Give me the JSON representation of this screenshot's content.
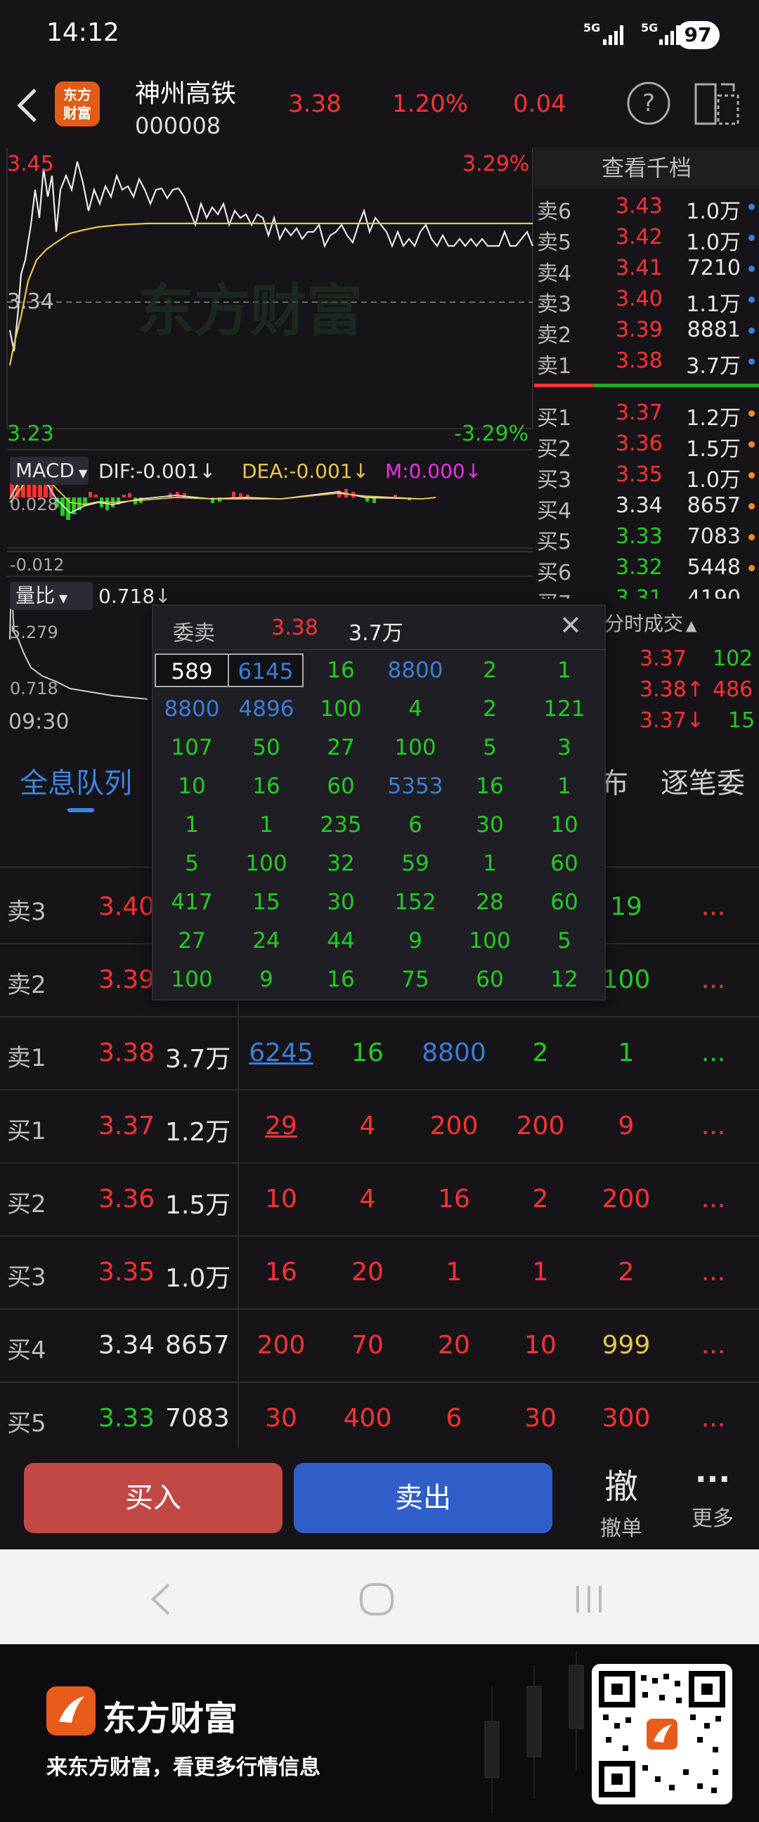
{
  "status_bar": {
    "time": "14:12",
    "net1": "5G",
    "net2": "5G",
    "battery": "97"
  },
  "header": {
    "logo_text_1": "东方",
    "logo_text_2": "财富",
    "stock_name": "神州高铁",
    "stock_code": "000008",
    "price": "3.38",
    "change_pct": "1.20%",
    "change": "0.04"
  },
  "chart": {
    "high_price": "3.45",
    "high_pct": "3.29%",
    "mid_price": "3.34",
    "low_price": "3.23",
    "low_pct": "-3.29%",
    "watermark": "东方财富",
    "macd_label": "MACD",
    "dif": "DIF:-0.001",
    "dea": "DEA:-0.001",
    "m": "M:0.000",
    "macd_top": "0.028",
    "macd_bottom": "-0.012",
    "volratio_label": "量比",
    "volratio_value": "0.718",
    "vr_top": "5.279",
    "vr_bottom": "0.718",
    "time_start": "09:30",
    "arrow_down": "↓",
    "colors": {
      "up": "#ff3232",
      "down": "#22cc22",
      "price_line": "#e8e8e8",
      "avg_line": "#e6c84a"
    }
  },
  "order_book": {
    "title": "查看千档",
    "asks": [
      {
        "label": "卖6",
        "price": "3.43",
        "vol": "1.0万"
      },
      {
        "label": "卖5",
        "price": "3.42",
        "vol": "1.0万"
      },
      {
        "label": "卖4",
        "price": "3.41",
        "vol": "7210"
      },
      {
        "label": "卖3",
        "price": "3.40",
        "vol": "1.1万"
      },
      {
        "label": "卖2",
        "price": "3.39",
        "vol": "8881"
      },
      {
        "label": "卖1",
        "price": "3.38",
        "vol": "3.7万"
      }
    ],
    "bids": [
      {
        "label": "买1",
        "price": "3.37",
        "vol": "1.2万"
      },
      {
        "label": "买2",
        "price": "3.36",
        "vol": "1.5万"
      },
      {
        "label": "买3",
        "price": "3.35",
        "vol": "1.0万"
      },
      {
        "label": "买4",
        "price": "3.34",
        "vol": "8657"
      },
      {
        "label": "买5",
        "price": "3.33",
        "vol": "7083"
      },
      {
        "label": "买6",
        "price": "3.32",
        "vol": "5448"
      },
      {
        "label": "买7",
        "price": "3.31",
        "vol": "4190"
      }
    ]
  },
  "ticks": {
    "title": "分时成交",
    "rows": [
      {
        "price": "3.37",
        "vol": "102"
      },
      {
        "price": "3.38↑",
        "vol": "486"
      },
      {
        "price": "3.37↓",
        "vol": "15"
      }
    ]
  },
  "tabs": {
    "active": "全息队列",
    "partial1": "布",
    "partial2": "逐笔委"
  },
  "queue": {
    "rows": [
      {
        "label": "卖3",
        "price": "3.40",
        "vol": "",
        "cells": [
          "",
          "",
          "",
          "",
          "19"
        ],
        "more": "..."
      },
      {
        "label": "卖2",
        "price": "3.39",
        "vol": "",
        "cells": [
          "",
          "",
          "",
          "",
          "100"
        ],
        "more": "..."
      },
      {
        "label": "卖1",
        "price": "3.38",
        "vol": "3.7万",
        "cells": [
          "6245",
          "16",
          "8800",
          "2",
          "1"
        ],
        "more": "..."
      },
      {
        "label": "买1",
        "price": "3.37",
        "vol": "1.2万",
        "cells": [
          "29",
          "4",
          "200",
          "200",
          "9"
        ],
        "more": "..."
      },
      {
        "label": "买2",
        "price": "3.36",
        "vol": "1.5万",
        "cells": [
          "10",
          "4",
          "16",
          "2",
          "200"
        ],
        "more": "..."
      },
      {
        "label": "买3",
        "price": "3.35",
        "vol": "1.0万",
        "cells": [
          "16",
          "20",
          "1",
          "1",
          "2"
        ],
        "more": "..."
      },
      {
        "label": "买4",
        "price": "3.34",
        "vol": "8657",
        "cells": [
          "200",
          "70",
          "20",
          "10",
          "999"
        ],
        "more": "..."
      },
      {
        "label": "买5",
        "price": "3.33",
        "vol": "7083",
        "cells": [
          "30",
          "400",
          "6",
          "30",
          "300"
        ],
        "more": "..."
      }
    ]
  },
  "popup": {
    "title": "委卖",
    "price": "3.38",
    "vol": "3.7万",
    "close": "✕",
    "grid": [
      [
        "589",
        "6145",
        "16",
        "8800",
        "2",
        "1"
      ],
      [
        "8800",
        "4896",
        "100",
        "4",
        "2",
        "121"
      ],
      [
        "107",
        "50",
        "27",
        "100",
        "5",
        "3"
      ],
      [
        "10",
        "16",
        "60",
        "5353",
        "16",
        "1"
      ],
      [
        "1",
        "1",
        "235",
        "6",
        "30",
        "10"
      ],
      [
        "5",
        "100",
        "32",
        "59",
        "1",
        "60"
      ],
      [
        "417",
        "15",
        "30",
        "152",
        "28",
        "60"
      ],
      [
        "27",
        "24",
        "44",
        "9",
        "100",
        "5"
      ],
      [
        "100",
        "9",
        "16",
        "75",
        "60",
        "12"
      ]
    ]
  },
  "actions": {
    "buy": "买入",
    "sell": "卖出",
    "cancel_icon": "撤",
    "cancel": "撤单",
    "more_icon": "···",
    "more": "更多"
  },
  "footer": {
    "brand": "东方财富",
    "slogan": "来东方财富，看更多行情信息"
  }
}
